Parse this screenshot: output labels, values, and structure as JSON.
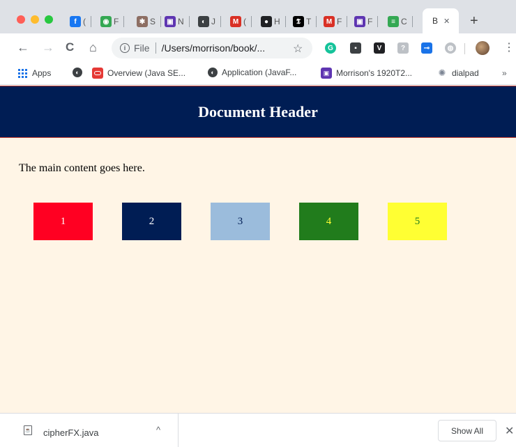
{
  "browser": {
    "tabs": [
      {
        "icon": "facebook-icon",
        "letter": "f",
        "label": "(",
        "color": "#1877f2"
      },
      {
        "icon": "android-icon",
        "letter": "◉",
        "label": "F",
        "color": "#34a853"
      },
      {
        "icon": "bug-icon",
        "letter": "✱",
        "label": "S",
        "color": "#8d6e63"
      },
      {
        "icon": "purple-app-icon",
        "letter": "▣",
        "label": "N",
        "color": "#5e35b1"
      },
      {
        "icon": "globe-icon",
        "letter": "◐",
        "label": "J",
        "color": "#3c4043"
      },
      {
        "icon": "gmail-icon",
        "letter": "M",
        "label": "(",
        "color": "#d93025"
      },
      {
        "icon": "circle-app-icon",
        "letter": "●",
        "label": "H",
        "color": "#202124"
      },
      {
        "icon": "nyt-icon",
        "letter": "𝕿",
        "label": "T",
        "color": "#000000"
      },
      {
        "icon": "gmail-icon",
        "letter": "M",
        "label": "F",
        "color": "#d93025"
      },
      {
        "icon": "purple-app-icon",
        "letter": "▣",
        "label": "F",
        "color": "#5e35b1"
      },
      {
        "icon": "green-app-icon",
        "letter": "≡",
        "label": "C",
        "color": "#34a853"
      }
    ],
    "active_tab": {
      "label": "B",
      "close": "✕"
    },
    "new_tab": "+",
    "nav": {
      "back": "←",
      "forward": "→",
      "reload": "C",
      "home": "⌂"
    },
    "address": {
      "info": "i",
      "scheme": "File",
      "path": "/Users/morrison/book/..."
    },
    "star": "☆",
    "extensions": [
      {
        "icon": "grammarly-icon",
        "glyph": "G",
        "color": "#15c39a",
        "round": true
      },
      {
        "icon": "dark-square-icon",
        "glyph": "▪",
        "color": "#3c4043",
        "round": false
      },
      {
        "icon": "v-icon",
        "glyph": "V",
        "color": "#202124",
        "round": false
      },
      {
        "icon": "shield-icon",
        "glyph": "?",
        "color": "#bdc1c6",
        "round": false
      },
      {
        "icon": "toggle-icon",
        "glyph": "⊸",
        "color": "#1a73e8",
        "round": false
      },
      {
        "icon": "coin-icon",
        "glyph": "◍",
        "color": "#bdc1c6",
        "round": true
      }
    ],
    "menu": "⋮",
    "bookmarks": [
      {
        "icon": "apps-icon",
        "label": "Apps"
      },
      {
        "icon": "globe-icon",
        "label": ""
      },
      {
        "icon": "oracle-icon",
        "label": "Overview (Java SE..."
      },
      {
        "icon": "globe-icon",
        "label": "Application (JavaF..."
      },
      {
        "icon": "purple-app-icon",
        "label": "Morrison's 1920T2..."
      },
      {
        "icon": "dialpad-icon",
        "label": "dialpad"
      }
    ],
    "bookmarks_more": "»"
  },
  "page": {
    "header": "Document Header",
    "main_text": "The main content goes here.",
    "boxes": [
      {
        "label": "1",
        "bg": "#ff0022",
        "fg": "#ffffff"
      },
      {
        "label": "2",
        "bg": "#001d54",
        "fg": "#ffffff"
      },
      {
        "label": "3",
        "bg": "#9bbcdc",
        "fg": "#001d54"
      },
      {
        "label": "4",
        "bg": "#217c1c",
        "fg": "#ffff33"
      },
      {
        "label": "5",
        "bg": "#ffff33",
        "fg": "#217c1c"
      }
    ]
  },
  "downloads": {
    "file_name": "cipherFX.java",
    "chevron": "^",
    "show_all": "Show All",
    "close": "✕"
  }
}
